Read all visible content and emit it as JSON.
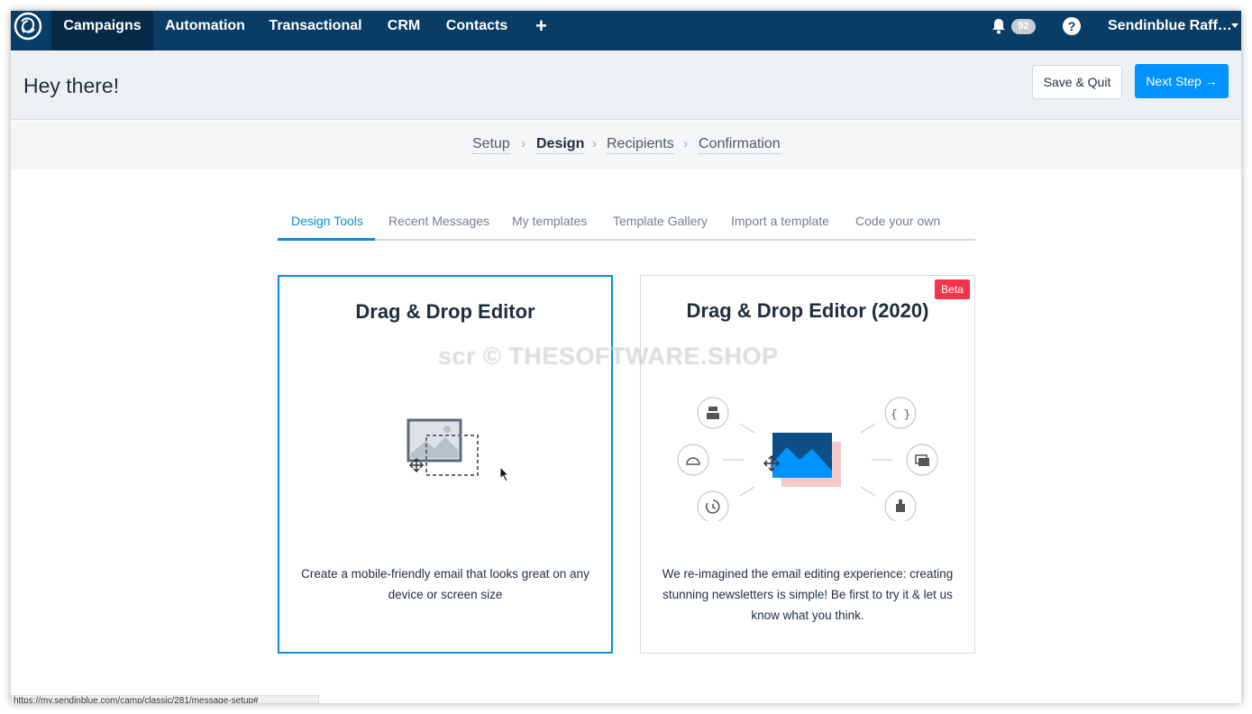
{
  "nav": {
    "items": [
      "Campaigns",
      "Automation",
      "Transactional",
      "CRM",
      "Contacts"
    ],
    "add_label": "+",
    "notifications_count": "92",
    "help_label": "?",
    "user_name": "Sendinblue Raff…"
  },
  "header": {
    "title": "Hey there!",
    "save_label": "Save & Quit",
    "next_label": "Next Step →"
  },
  "steps": [
    "Setup",
    "Design",
    "Recipients",
    "Confirmation"
  ],
  "tabs": [
    "Design Tools",
    "Recent Messages",
    "My templates",
    "Template Gallery",
    "Import a template",
    "Code your own"
  ],
  "cards": [
    {
      "title": "Drag & Drop Editor",
      "description": "Create a mobile-friendly email that looks great on any device or screen size"
    },
    {
      "title": "Drag & Drop Editor (2020)",
      "badge": "Beta",
      "description": "We re-imagined the email editing experience: creating stunning newsletters is simple! Be first to try it & let us know what you think."
    }
  ],
  "watermark": "scr © THESOFTWARE.SHOP",
  "status_url": "https://my.sendinblue.com/camp/classic/281/message-setup#",
  "colors": {
    "nav_bg": "#0a3d66",
    "primary": "#0092ff",
    "accent": "#0b8ed6",
    "beta": "#f5334a"
  }
}
